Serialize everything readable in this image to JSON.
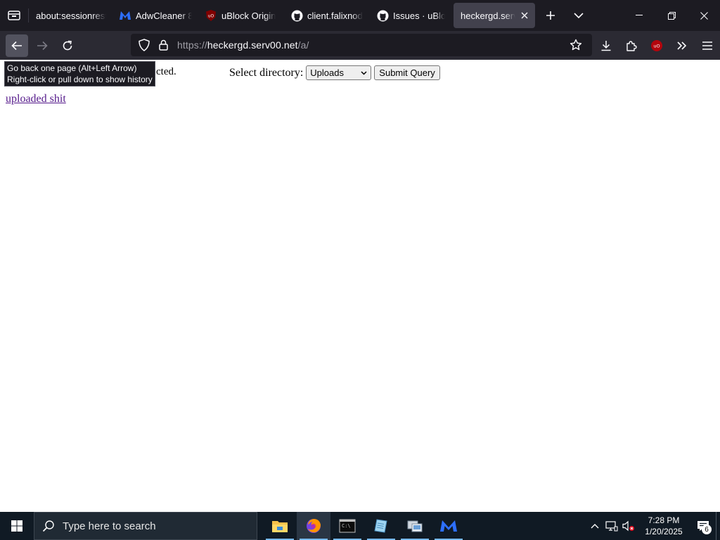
{
  "browser": {
    "tabs": [
      {
        "label": "about:sessionresto",
        "icon": "session-restore-icon",
        "active": false
      },
      {
        "label": "AdwCleaner 8",
        "icon": "malwarebytes-icon",
        "active": false
      },
      {
        "label": "uBlock Origin",
        "icon": "ublock-icon",
        "active": false
      },
      {
        "label": "client.falixnod",
        "icon": "github-icon",
        "active": false
      },
      {
        "label": "Issues · uBlock",
        "icon": "github-icon",
        "active": false
      },
      {
        "label": "heckergd.serv00",
        "icon": "none",
        "active": true
      }
    ],
    "url": {
      "prefix": "https://",
      "host": "heckergd.serv00.net",
      "path": "/a/"
    },
    "tooltip": {
      "line1": "Go back one page (Alt+Left Arrow)",
      "line2": "Right-click or pull down to show history"
    }
  },
  "page": {
    "status_text": "cted.",
    "select_label": "Select directory:",
    "select_value": "Uploads",
    "submit_label": "Submit Query",
    "link_text": "uploaded shit"
  },
  "taskbar": {
    "search_placeholder": "Type here to search",
    "time": "7:28 PM",
    "date": "1/20/2025",
    "notification_count": "6",
    "apps": [
      "file-explorer-icon",
      "firefox-icon",
      "terminal-icon",
      "notepad-icon",
      "network-app-icon",
      "malwarebytes-icon"
    ]
  },
  "colors": {
    "tabbar_bg": "#1c1b22",
    "navbar_bg": "#2b2a33",
    "link_visited": "#551a8b",
    "taskbar_bg": "#101a24"
  }
}
